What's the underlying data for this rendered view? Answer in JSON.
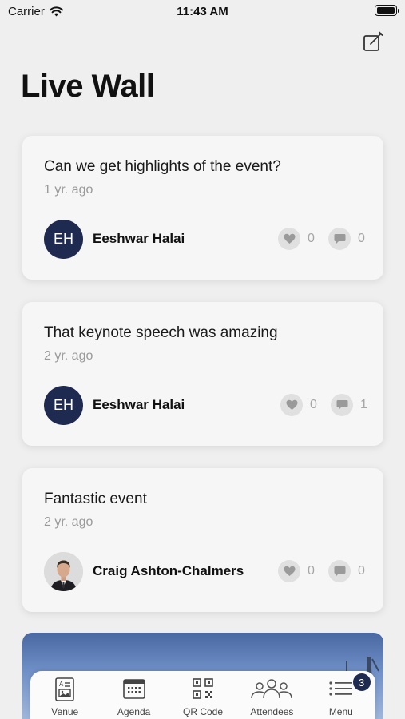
{
  "status_bar": {
    "carrier": "Carrier",
    "time": "11:43 AM"
  },
  "page": {
    "title": "Live Wall"
  },
  "posts": [
    {
      "message": "Can we get highlights of the event?",
      "time": "1 yr. ago",
      "author": "Eeshwar Halai",
      "initials": "EH",
      "likes": "0",
      "comments": "0"
    },
    {
      "message": "That keynote speech was amazing",
      "time": "2 yr. ago",
      "author": "Eeshwar Halai",
      "initials": "EH",
      "likes": "0",
      "comments": "1"
    },
    {
      "message": "Fantastic event",
      "time": "2 yr. ago",
      "author": "Craig Ashton-Chalmers",
      "initials": "",
      "likes": "0",
      "comments": "0"
    }
  ],
  "tab_bar": {
    "venue": "Venue",
    "agenda": "Agenda",
    "qr_code": "QR Code",
    "attendees": "Attendees",
    "menu": "Menu",
    "menu_badge": "3"
  },
  "colors": {
    "accent": "#1e2a4f",
    "background": "#efefef",
    "card": "#f6f6f6",
    "muted": "#9a9a9a"
  },
  "icons": [
    "wifi-icon",
    "battery-icon",
    "compose-icon",
    "heart-icon",
    "comment-icon",
    "venue-icon",
    "agenda-icon",
    "qr-code-icon",
    "attendees-icon",
    "menu-icon"
  ]
}
